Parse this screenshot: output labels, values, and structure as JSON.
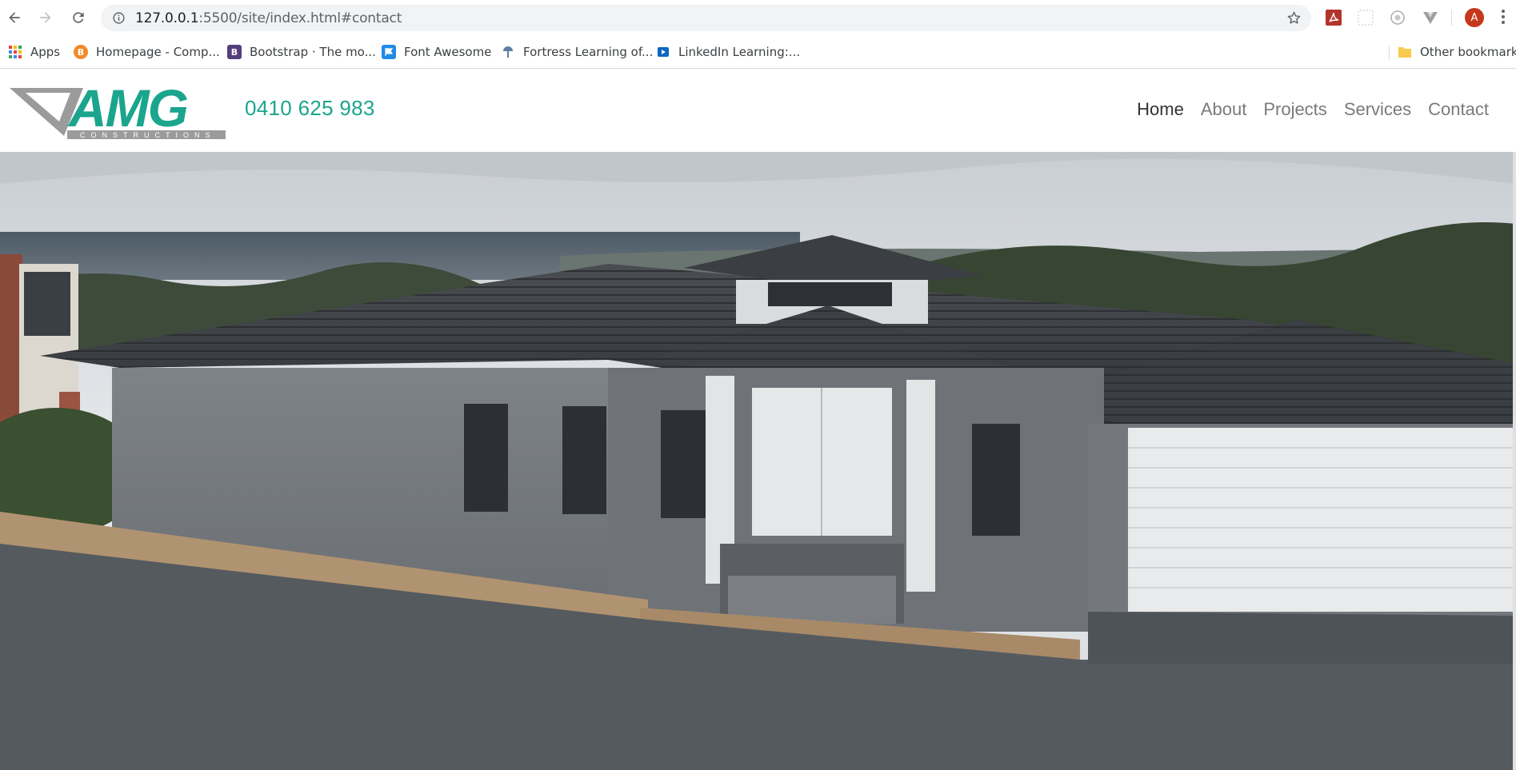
{
  "browser": {
    "url_host": "127.0.0.1",
    "url_rest": ":5500/site/index.html#contact",
    "profile_initial": "A",
    "bookmarks": [
      {
        "label": "Apps",
        "icon": "apps-grid-icon"
      },
      {
        "label": "Homepage - Comp...",
        "icon": "homepage-favicon"
      },
      {
        "label": "Bootstrap · The mo...",
        "icon": "bootstrap-favicon"
      },
      {
        "label": "Font Awesome",
        "icon": "font-awesome-favicon"
      },
      {
        "label": "Fortress Learning of...",
        "icon": "fortress-favicon"
      },
      {
        "label": "LinkedIn Learning:...",
        "icon": "linkedin-learning-favicon"
      }
    ],
    "other_bookmarks": "Other bookmarks"
  },
  "site": {
    "logo_text": "AMG",
    "logo_subtext": "CONSTRUCTIONS",
    "phone": "0410 625 983",
    "nav": [
      {
        "label": "Home",
        "active": true
      },
      {
        "label": "About",
        "active": false
      },
      {
        "label": "Projects",
        "active": false
      },
      {
        "label": "Services",
        "active": false
      },
      {
        "label": "Contact",
        "active": false
      }
    ],
    "colors": {
      "brand": "#1ba58d",
      "logo_grey": "#9b9b9b"
    }
  }
}
